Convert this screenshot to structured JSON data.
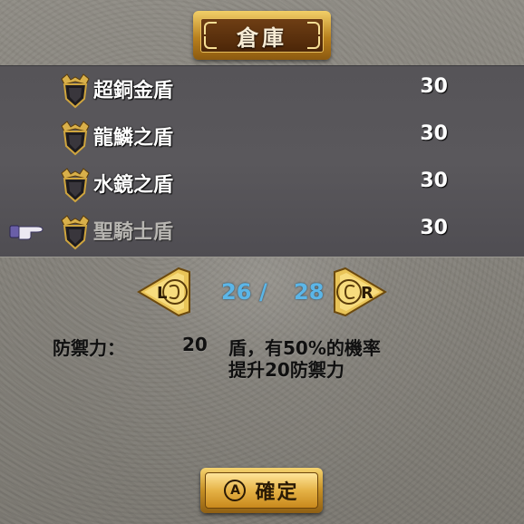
{
  "header": {
    "title": "倉庫"
  },
  "items": [
    {
      "name": "超銅金盾",
      "qty": "30",
      "dim": false,
      "icon": "shield-icon"
    },
    {
      "name": "龍鱗之盾",
      "qty": "30",
      "dim": false,
      "icon": "shield-icon"
    },
    {
      "name": "水鏡之盾",
      "qty": "30",
      "dim": false,
      "icon": "shield-icon"
    },
    {
      "name": "聖騎士盾",
      "qty": "30",
      "dim": true,
      "icon": "shield-icon"
    }
  ],
  "cursor": {
    "icon": "pointing-hand-icon",
    "row": 3
  },
  "pager": {
    "left_label": "L",
    "right_label": "R",
    "current": "26",
    "separator": "/",
    "total": "28"
  },
  "description": {
    "label": "防禦力：",
    "value": "20",
    "line1": "盾，有50%的機率",
    "line2": "提升20防禦力"
  },
  "confirm": {
    "button_glyph": "A",
    "label": "確定"
  },
  "colors": {
    "page_number": "#5bb6e8",
    "gold": "#e5b246",
    "panel": "#565458"
  }
}
